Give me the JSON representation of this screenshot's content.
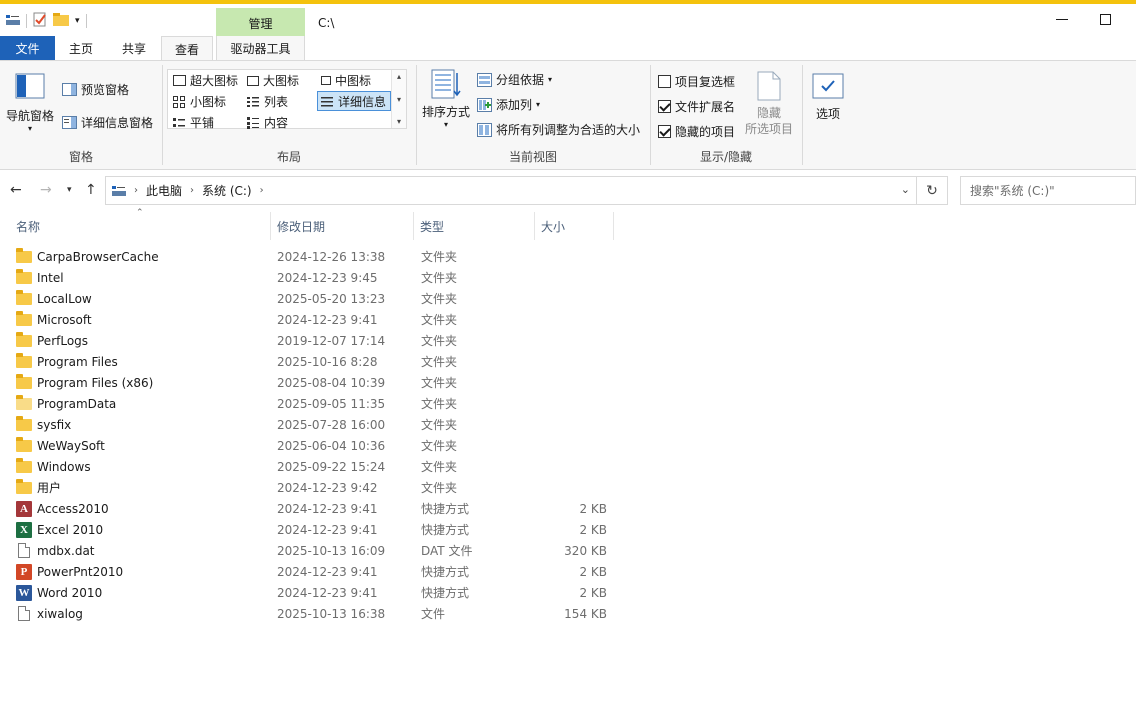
{
  "window": {
    "context_tab_label": "管理",
    "path_title": "C:\\"
  },
  "tabs": {
    "file": "文件",
    "home": "主页",
    "share": "共享",
    "view": "查看",
    "drive_tools": "驱动器工具"
  },
  "ribbon": {
    "panes": {
      "group_name": "窗格",
      "nav_pane": "导航窗格",
      "preview_pane": "预览窗格",
      "details_pane": "详细信息窗格"
    },
    "layout": {
      "group_name": "布局",
      "items": [
        "超大图标",
        "大图标",
        "中图标",
        "小图标",
        "列表",
        "详细信息",
        "平铺",
        "内容"
      ],
      "selected": "详细信息"
    },
    "current_view": {
      "group_name": "当前视图",
      "sort_by": "排序方式",
      "group_by": "分组依据",
      "add_columns": "添加列",
      "fit_columns": "将所有列调整为合适的大小"
    },
    "show_hide": {
      "group_name": "显示/隐藏",
      "item_checkboxes": {
        "label": "项目复选框",
        "checked": false
      },
      "file_extensions": {
        "label": "文件扩展名",
        "checked": true
      },
      "hidden_items": {
        "label": "隐藏的项目",
        "checked": true
      },
      "hide_selected": "隐藏\n所选项目"
    },
    "options": "选项"
  },
  "address": {
    "crumbs": [
      "此电脑",
      "系统 (C:)"
    ],
    "search_placeholder": "搜索\"系统 (C:)\""
  },
  "columns": {
    "name": "名称",
    "date": "修改日期",
    "type": "类型",
    "size": "大小"
  },
  "files": [
    {
      "name": "CarpaBrowserCache",
      "date": "2024-12-26 13:38",
      "type": "文件夹",
      "size": "",
      "icon": "folder-icon"
    },
    {
      "name": "Intel",
      "date": "2024-12-23 9:45",
      "type": "文件夹",
      "size": "",
      "icon": "folder-icon"
    },
    {
      "name": "LocalLow",
      "date": "2025-05-20 13:23",
      "type": "文件夹",
      "size": "",
      "icon": "folder-icon"
    },
    {
      "name": "Microsoft",
      "date": "2024-12-23 9:41",
      "type": "文件夹",
      "size": "",
      "icon": "folder-icon"
    },
    {
      "name": "PerfLogs",
      "date": "2019-12-07 17:14",
      "type": "文件夹",
      "size": "",
      "icon": "folder-icon"
    },
    {
      "name": "Program Files",
      "date": "2025-10-16 8:28",
      "type": "文件夹",
      "size": "",
      "icon": "folder-icon"
    },
    {
      "name": "Program Files (x86)",
      "date": "2025-08-04 10:39",
      "type": "文件夹",
      "size": "",
      "icon": "folder-icon"
    },
    {
      "name": "ProgramData",
      "date": "2025-09-05 11:35",
      "type": "文件夹",
      "size": "",
      "icon": "folder-icon-light"
    },
    {
      "name": "sysfix",
      "date": "2025-07-28 16:00",
      "type": "文件夹",
      "size": "",
      "icon": "folder-icon"
    },
    {
      "name": "WeWaySoft",
      "date": "2025-06-04 10:36",
      "type": "文件夹",
      "size": "",
      "icon": "folder-icon"
    },
    {
      "name": "Windows",
      "date": "2025-09-22 15:24",
      "type": "文件夹",
      "size": "",
      "icon": "folder-icon"
    },
    {
      "name": "用户",
      "date": "2024-12-23 9:42",
      "type": "文件夹",
      "size": "",
      "icon": "folder-icon"
    },
    {
      "name": "Access2010",
      "date": "2024-12-23 9:41",
      "type": "快捷方式",
      "size": "2 KB",
      "icon": "access-icon"
    },
    {
      "name": "Excel 2010",
      "date": "2024-12-23 9:41",
      "type": "快捷方式",
      "size": "2 KB",
      "icon": "excel-icon"
    },
    {
      "name": "mdbx.dat",
      "date": "2025-10-13 16:09",
      "type": "DAT 文件",
      "size": "320 KB",
      "icon": "file-icon"
    },
    {
      "name": "PowerPnt2010",
      "date": "2024-12-23 9:41",
      "type": "快捷方式",
      "size": "2 KB",
      "icon": "powerpoint-icon"
    },
    {
      "name": "Word 2010",
      "date": "2024-12-23 9:41",
      "type": "快捷方式",
      "size": "2 KB",
      "icon": "word-icon"
    },
    {
      "name": "xiwalog",
      "date": "2025-10-13 16:38",
      "type": "文件",
      "size": "154 KB",
      "icon": "file-icon"
    }
  ],
  "colors": {
    "accent": "#1e62b8",
    "context_tab": "#c7e8b0",
    "top_strip": "#f4c20d",
    "access": "#a4373a",
    "excel": "#1d6f42",
    "powerpoint": "#d24726",
    "word": "#2b579a"
  }
}
